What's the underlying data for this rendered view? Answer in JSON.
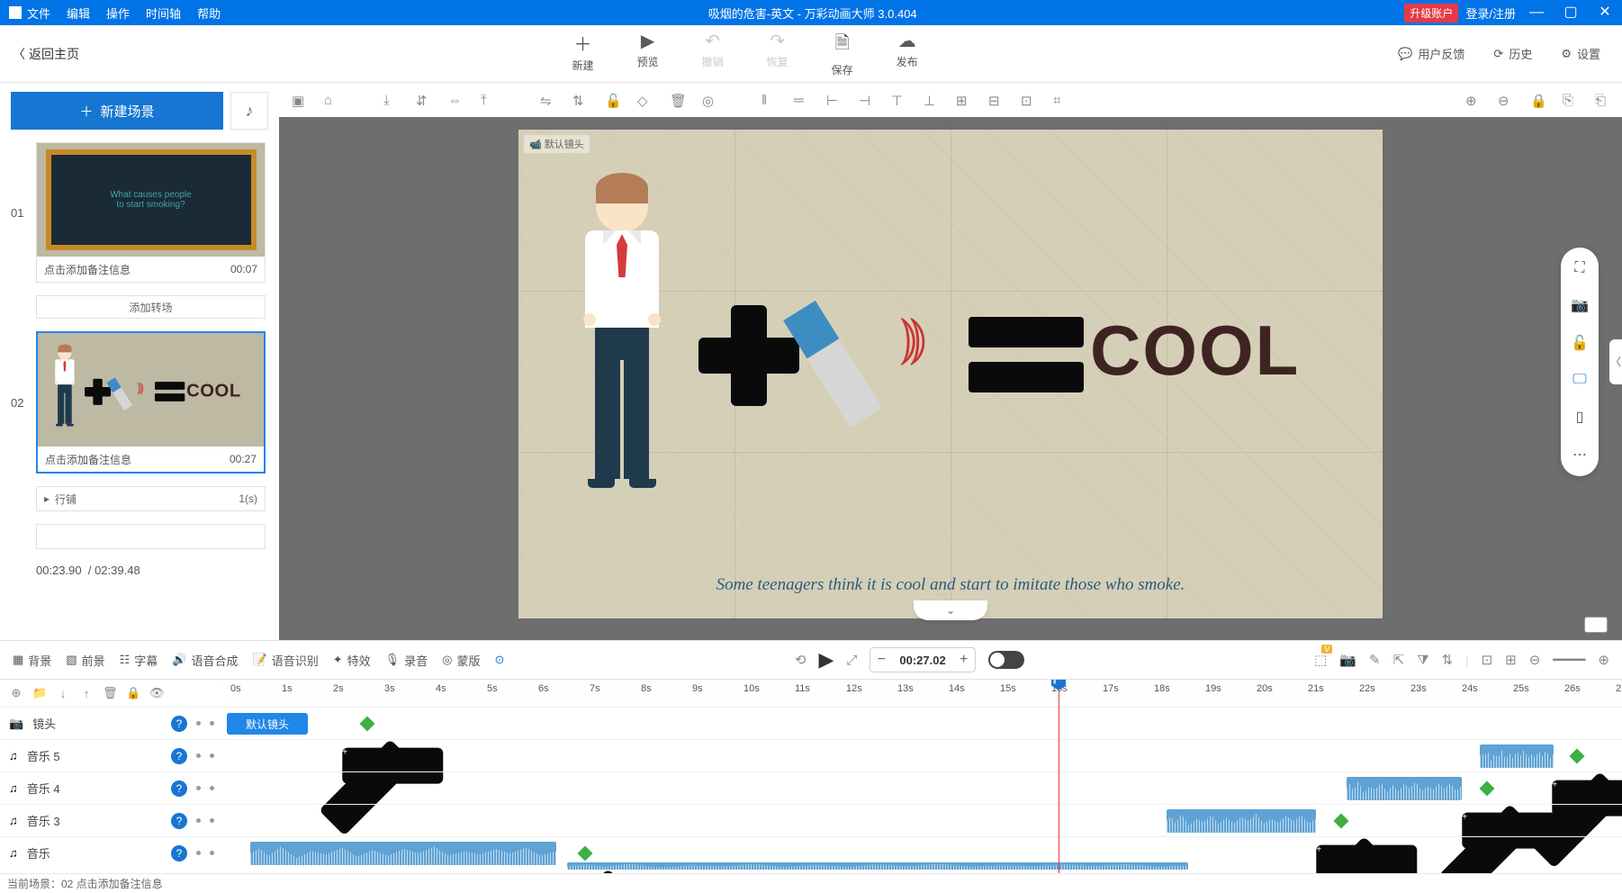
{
  "title_bar": {
    "menus": [
      "文件",
      "编辑",
      "操作",
      "时间轴",
      "帮助"
    ],
    "doc_title": "吸烟的危害-英文 - 万彩动画大师 3.0.404",
    "upgrade_label": "升级账户",
    "login_label": "登录/注册"
  },
  "top_actions": {
    "back": "返回主页",
    "items": [
      {
        "icon": "＋",
        "label": "新建"
      },
      {
        "icon": "▶",
        "label": "预览"
      },
      {
        "icon": "↶",
        "label": "撤销",
        "disabled": true
      },
      {
        "icon": "↷",
        "label": "恢复",
        "disabled": true
      },
      {
        "icon": "🗎",
        "label": "保存"
      },
      {
        "icon": "☁",
        "label": "发布"
      }
    ],
    "right": [
      {
        "icon": "💬",
        "label": "用户反馈"
      },
      {
        "icon": "⟳",
        "label": "历史"
      },
      {
        "icon": "⚙",
        "label": "设置"
      }
    ]
  },
  "left_panel": {
    "new_scene": "新建场景",
    "scenes": [
      {
        "num": "01",
        "note": "点击添加备注信息",
        "duration": "00:07",
        "thumb_text1": "What causes people",
        "thumb_text2": "to start smoking?"
      },
      {
        "num": "02",
        "note": "点击添加备注信息",
        "duration": "00:27"
      }
    ],
    "transition": "添加转场",
    "play_row": {
      "label": "行铺",
      "val": "1(s)"
    },
    "time": {
      "cur": "00:23.90",
      "total": "/ 02:39.48"
    }
  },
  "canvas": {
    "cam_label": "默认镜头",
    "cool_text": "COOL",
    "caption": "Some teenagers think it is cool and start to imitate those who smoke."
  },
  "tl_toolbar": {
    "left": [
      {
        "icon": "▦",
        "label": "背景"
      },
      {
        "icon": "▧",
        "label": "前景"
      },
      {
        "icon": "☷",
        "label": "字幕"
      },
      {
        "icon": "🔊",
        "label": "语音合成"
      },
      {
        "icon": "📝",
        "label": "语音识别"
      },
      {
        "icon": "✦",
        "label": "特效"
      },
      {
        "icon": "🎙",
        "label": "录音"
      },
      {
        "icon": "◎",
        "label": "蒙版"
      }
    ],
    "time": "00:27.02"
  },
  "timeline": {
    "ruler_range_s": 27,
    "tracks": [
      {
        "icon": "📷",
        "name": "镜头"
      },
      {
        "icon": "♫",
        "name": "音乐 5"
      },
      {
        "icon": "♫",
        "name": "音乐 4"
      },
      {
        "icon": "♫",
        "name": "音乐 3"
      },
      {
        "icon": "♫",
        "name": "音乐"
      }
    ],
    "cam_clip": "默认镜头"
  },
  "status_bar": "当前场景：02  点击添加备注信息"
}
